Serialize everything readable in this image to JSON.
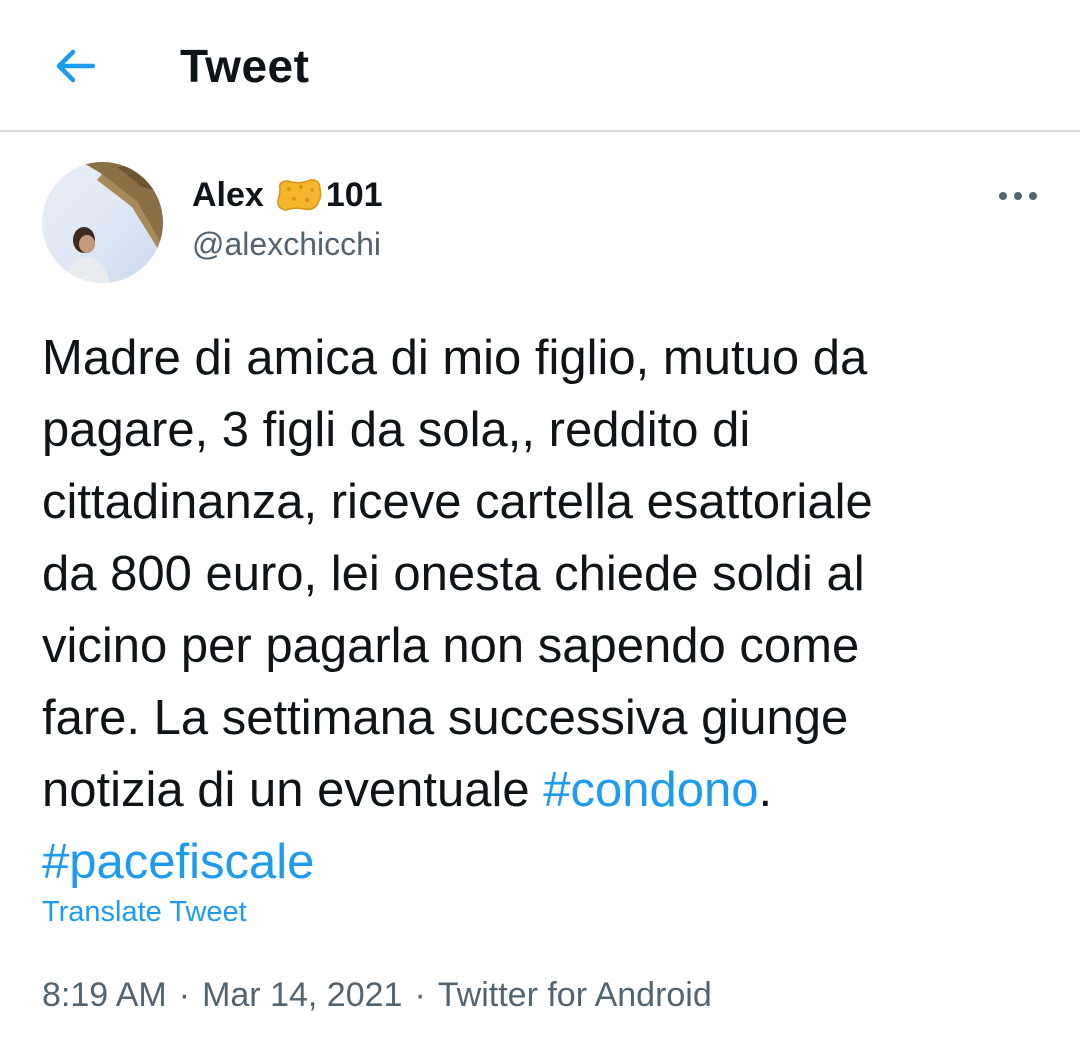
{
  "header": {
    "title": "Tweet",
    "back_icon": "arrow-left-icon",
    "accent_color": "#1d9bf0"
  },
  "author": {
    "name": "Alex",
    "name_suffix": "101",
    "emoji_icon": "sponge-icon",
    "handle": "@alexchicchi"
  },
  "tweet": {
    "text_lines": [
      "Madre di amica di mio figlio, mutuo da",
      "pagare, 3 figli da sola,, reddito di",
      "cittadinanza, riceve cartella esattoriale",
      "da 800 euro, lei onesta chiede soldi al",
      "vicino per pagarla non sapendo come",
      "fare. La settimana successiva giunge"
    ],
    "last_line_prefix": "notizia di un eventuale ",
    "hashtag_1": "#condono",
    "last_line_suffix": ".",
    "hashtag_2": "#pacefiscale",
    "translate_label": "Translate Tweet"
  },
  "meta": {
    "time": "8:19 AM",
    "separator": "·",
    "date": "Mar 14, 2021",
    "source": "Twitter for Android"
  }
}
